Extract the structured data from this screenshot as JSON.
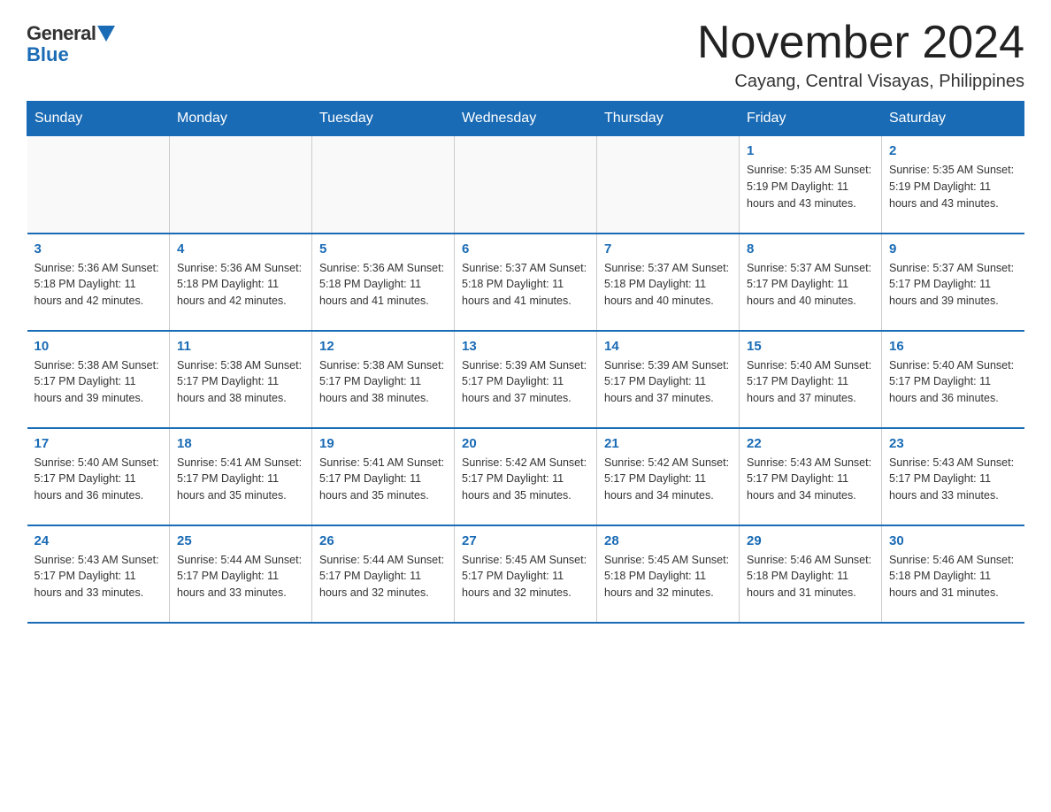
{
  "logo": {
    "general": "General",
    "blue": "Blue"
  },
  "header": {
    "title": "November 2024",
    "subtitle": "Cayang, Central Visayas, Philippines"
  },
  "weekdays": [
    "Sunday",
    "Monday",
    "Tuesday",
    "Wednesday",
    "Thursday",
    "Friday",
    "Saturday"
  ],
  "weeks": [
    [
      {
        "day": "",
        "info": ""
      },
      {
        "day": "",
        "info": ""
      },
      {
        "day": "",
        "info": ""
      },
      {
        "day": "",
        "info": ""
      },
      {
        "day": "",
        "info": ""
      },
      {
        "day": "1",
        "info": "Sunrise: 5:35 AM\nSunset: 5:19 PM\nDaylight: 11 hours\nand 43 minutes."
      },
      {
        "day": "2",
        "info": "Sunrise: 5:35 AM\nSunset: 5:19 PM\nDaylight: 11 hours\nand 43 minutes."
      }
    ],
    [
      {
        "day": "3",
        "info": "Sunrise: 5:36 AM\nSunset: 5:18 PM\nDaylight: 11 hours\nand 42 minutes."
      },
      {
        "day": "4",
        "info": "Sunrise: 5:36 AM\nSunset: 5:18 PM\nDaylight: 11 hours\nand 42 minutes."
      },
      {
        "day": "5",
        "info": "Sunrise: 5:36 AM\nSunset: 5:18 PM\nDaylight: 11 hours\nand 41 minutes."
      },
      {
        "day": "6",
        "info": "Sunrise: 5:37 AM\nSunset: 5:18 PM\nDaylight: 11 hours\nand 41 minutes."
      },
      {
        "day": "7",
        "info": "Sunrise: 5:37 AM\nSunset: 5:18 PM\nDaylight: 11 hours\nand 40 minutes."
      },
      {
        "day": "8",
        "info": "Sunrise: 5:37 AM\nSunset: 5:17 PM\nDaylight: 11 hours\nand 40 minutes."
      },
      {
        "day": "9",
        "info": "Sunrise: 5:37 AM\nSunset: 5:17 PM\nDaylight: 11 hours\nand 39 minutes."
      }
    ],
    [
      {
        "day": "10",
        "info": "Sunrise: 5:38 AM\nSunset: 5:17 PM\nDaylight: 11 hours\nand 39 minutes."
      },
      {
        "day": "11",
        "info": "Sunrise: 5:38 AM\nSunset: 5:17 PM\nDaylight: 11 hours\nand 38 minutes."
      },
      {
        "day": "12",
        "info": "Sunrise: 5:38 AM\nSunset: 5:17 PM\nDaylight: 11 hours\nand 38 minutes."
      },
      {
        "day": "13",
        "info": "Sunrise: 5:39 AM\nSunset: 5:17 PM\nDaylight: 11 hours\nand 37 minutes."
      },
      {
        "day": "14",
        "info": "Sunrise: 5:39 AM\nSunset: 5:17 PM\nDaylight: 11 hours\nand 37 minutes."
      },
      {
        "day": "15",
        "info": "Sunrise: 5:40 AM\nSunset: 5:17 PM\nDaylight: 11 hours\nand 37 minutes."
      },
      {
        "day": "16",
        "info": "Sunrise: 5:40 AM\nSunset: 5:17 PM\nDaylight: 11 hours\nand 36 minutes."
      }
    ],
    [
      {
        "day": "17",
        "info": "Sunrise: 5:40 AM\nSunset: 5:17 PM\nDaylight: 11 hours\nand 36 minutes."
      },
      {
        "day": "18",
        "info": "Sunrise: 5:41 AM\nSunset: 5:17 PM\nDaylight: 11 hours\nand 35 minutes."
      },
      {
        "day": "19",
        "info": "Sunrise: 5:41 AM\nSunset: 5:17 PM\nDaylight: 11 hours\nand 35 minutes."
      },
      {
        "day": "20",
        "info": "Sunrise: 5:42 AM\nSunset: 5:17 PM\nDaylight: 11 hours\nand 35 minutes."
      },
      {
        "day": "21",
        "info": "Sunrise: 5:42 AM\nSunset: 5:17 PM\nDaylight: 11 hours\nand 34 minutes."
      },
      {
        "day": "22",
        "info": "Sunrise: 5:43 AM\nSunset: 5:17 PM\nDaylight: 11 hours\nand 34 minutes."
      },
      {
        "day": "23",
        "info": "Sunrise: 5:43 AM\nSunset: 5:17 PM\nDaylight: 11 hours\nand 33 minutes."
      }
    ],
    [
      {
        "day": "24",
        "info": "Sunrise: 5:43 AM\nSunset: 5:17 PM\nDaylight: 11 hours\nand 33 minutes."
      },
      {
        "day": "25",
        "info": "Sunrise: 5:44 AM\nSunset: 5:17 PM\nDaylight: 11 hours\nand 33 minutes."
      },
      {
        "day": "26",
        "info": "Sunrise: 5:44 AM\nSunset: 5:17 PM\nDaylight: 11 hours\nand 32 minutes."
      },
      {
        "day": "27",
        "info": "Sunrise: 5:45 AM\nSunset: 5:17 PM\nDaylight: 11 hours\nand 32 minutes."
      },
      {
        "day": "28",
        "info": "Sunrise: 5:45 AM\nSunset: 5:18 PM\nDaylight: 11 hours\nand 32 minutes."
      },
      {
        "day": "29",
        "info": "Sunrise: 5:46 AM\nSunset: 5:18 PM\nDaylight: 11 hours\nand 31 minutes."
      },
      {
        "day": "30",
        "info": "Sunrise: 5:46 AM\nSunset: 5:18 PM\nDaylight: 11 hours\nand 31 minutes."
      }
    ]
  ]
}
